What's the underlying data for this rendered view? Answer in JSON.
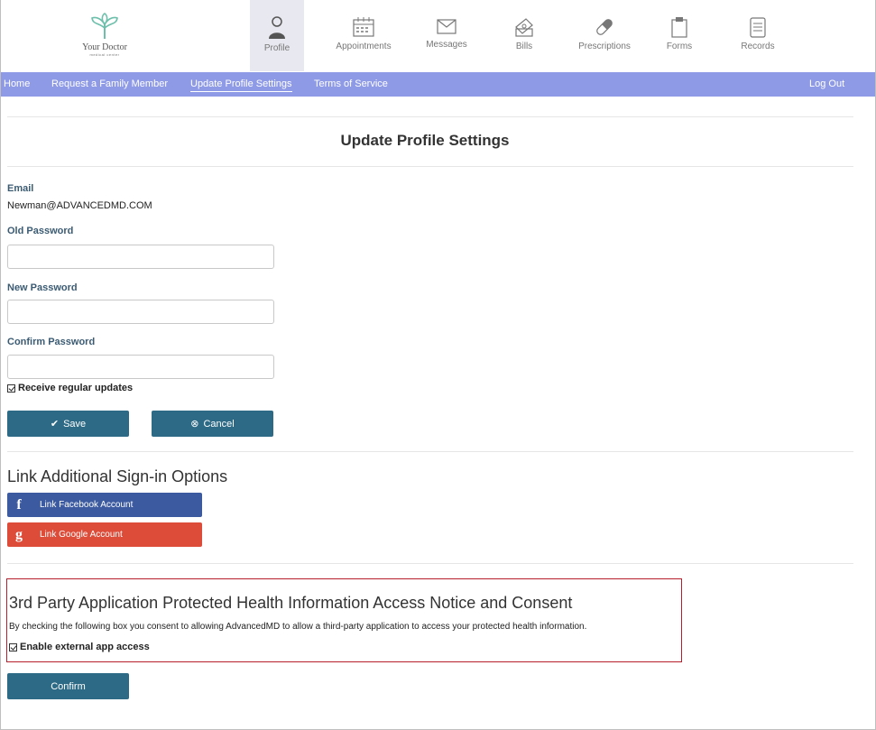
{
  "brand": {
    "name": "Your Doctor",
    "tagline": "medical center"
  },
  "top_nav": [
    {
      "label": "Profile",
      "icon": "user-icon",
      "active": true
    },
    {
      "label": "Appointments",
      "icon": "calendar-icon"
    },
    {
      "label": "Messages",
      "icon": "envelope-icon"
    },
    {
      "label": "Bills",
      "icon": "money-icon"
    },
    {
      "label": "Prescriptions",
      "icon": "pill-icon"
    },
    {
      "label": "Forms",
      "icon": "clipboard-icon"
    },
    {
      "label": "Records",
      "icon": "document-icon"
    }
  ],
  "sub_nav": {
    "home": "Home",
    "request_family": "Request a Family Member",
    "update_profile": "Update Profile Settings",
    "terms": "Terms of Service",
    "logout": "Log Out"
  },
  "page": {
    "title": "Update Profile Settings"
  },
  "form": {
    "email_label": "Email",
    "email_value": "Newman@ADVANCEDMD.COM",
    "old_password_label": "Old Password",
    "new_password_label": "New Password",
    "confirm_password_label": "Confirm Password",
    "old_password_value": "",
    "new_password_value": "",
    "confirm_password_value": "",
    "updates_label": "Receive regular updates",
    "updates_checked": true,
    "save_label": "Save",
    "cancel_label": "Cancel"
  },
  "link_options": {
    "heading": "Link Additional Sign-in Options",
    "facebook_label": "Link Facebook Account",
    "google_label": "Link Google Account"
  },
  "consent": {
    "heading": "3rd Party Application Protected Health Information Access Notice and Consent",
    "text": "By checking the following box you consent to allowing AdvancedMD to allow a third-party application to access your protected health information.",
    "checkbox_label": "Enable external app access",
    "checkbox_checked": true,
    "confirm_label": "Confirm"
  },
  "colors": {
    "subnav_bg": "#8e9ae6",
    "button_bg": "#2d6a85",
    "facebook": "#3b5aa0",
    "google": "#dd4b39",
    "consent_border": "#b51e2a",
    "label": "#3b5b73"
  }
}
